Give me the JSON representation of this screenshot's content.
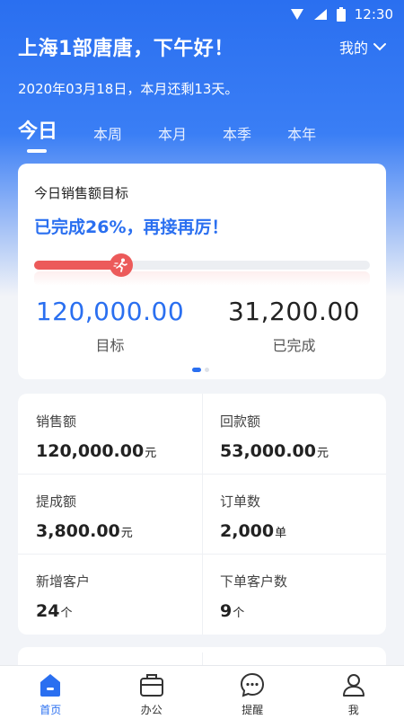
{
  "status_bar": {
    "time": "12:30"
  },
  "header": {
    "greeting": "上海1部唐唐，下午好！",
    "mine_label": "我的",
    "date_line": "2020年03月18日，本月还剩13天。"
  },
  "tabs": [
    {
      "label": "今日",
      "active": true
    },
    {
      "label": "本周",
      "active": false
    },
    {
      "label": "本月",
      "active": false
    },
    {
      "label": "本季",
      "active": false
    },
    {
      "label": "本年",
      "active": false
    }
  ],
  "target_card": {
    "title": "今日销售额目标",
    "progress_text": "已完成26%，再接再厉！",
    "progress_percent": 26,
    "target_value": "120,000.00",
    "target_label": "目标",
    "done_value": "31,200.00",
    "done_label": "已完成",
    "carousel": {
      "pages": 2,
      "current": 1
    }
  },
  "stats": [
    {
      "label": "销售额",
      "value": "120,000.00",
      "unit": "元"
    },
    {
      "label": "回款额",
      "value": "53,000.00",
      "unit": "元"
    },
    {
      "label": "提成额",
      "value": "3,800.00",
      "unit": "元"
    },
    {
      "label": "订单数",
      "value": "2,000",
      "unit": "单"
    },
    {
      "label": "新增客户",
      "value": "24",
      "unit": "个"
    },
    {
      "label": "下单客户数",
      "value": "9",
      "unit": "个"
    }
  ],
  "bottom_nav": [
    {
      "label": "首页",
      "icon": "home-icon",
      "active": true
    },
    {
      "label": "办公",
      "icon": "briefcase-icon",
      "active": false
    },
    {
      "label": "提醒",
      "icon": "chat-bubble-icon",
      "active": false
    },
    {
      "label": "我",
      "icon": "user-icon",
      "active": false
    }
  ],
  "colors": {
    "primary": "#2a6ff0",
    "progress": "#ec5a5a",
    "background": "#f2f4f8"
  }
}
